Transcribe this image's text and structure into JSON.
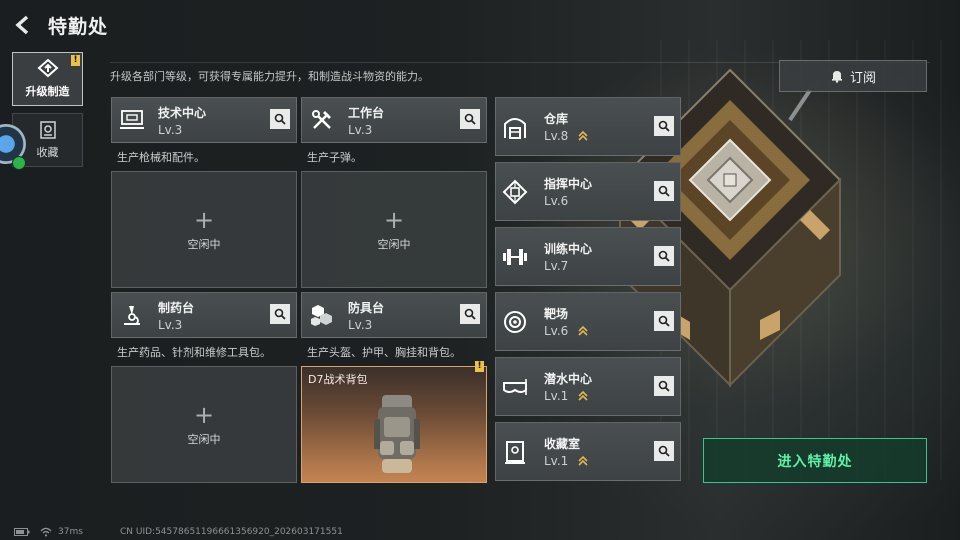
{
  "header": {
    "title": "特勤处"
  },
  "nav": [
    {
      "label": "升级制造",
      "active": true,
      "badge": "!"
    },
    {
      "label": "收藏",
      "active": false
    }
  ],
  "description": "升级各部门等级，可获得专属能力提升，和制造战斗物资的能力。",
  "subscribe_label": "订阅",
  "enter_label": "进入特勤处",
  "departments": [
    {
      "name": "技术中心",
      "level": "Lv.3",
      "desc": "生产枪械和配件。",
      "slot": {
        "plus": "+",
        "status": "空闲中"
      }
    },
    {
      "name": "工作台",
      "level": "Lv.3",
      "desc": "生产子弹。",
      "slot": {
        "plus": "+",
        "status": "空闲中"
      }
    },
    {
      "name": "制药台",
      "level": "Lv.3",
      "desc": "生产药品、针剂和维修工具包。",
      "slot": {
        "plus": "+",
        "status": "空闲中"
      }
    },
    {
      "name": "防具台",
      "level": "Lv.3",
      "desc": "生产头盔、护甲、胸挂和背包。",
      "slot": {
        "product": "D7战术背包",
        "badge": "!"
      }
    }
  ],
  "right_departments": [
    {
      "name": "仓库",
      "level": "Lv.8",
      "upgradable": true
    },
    {
      "name": "指挥中心",
      "level": "Lv.6",
      "upgradable": false
    },
    {
      "name": "训练中心",
      "level": "Lv.7",
      "upgradable": false
    },
    {
      "name": "靶场",
      "level": "Lv.6",
      "upgradable": true
    },
    {
      "name": "潜水中心",
      "level": "Lv.1",
      "upgradable": true
    },
    {
      "name": "收藏室",
      "level": "Lv.1",
      "upgradable": true
    }
  ],
  "status_bar": {
    "ping": "37ms",
    "uid": "CN UID:5457865119666135692­0_202603171551"
  },
  "colors": {
    "accent_green": "#5ef2a6",
    "upgrade_gold": "#e2b84a",
    "badge_yellow": "#e9c246"
  }
}
